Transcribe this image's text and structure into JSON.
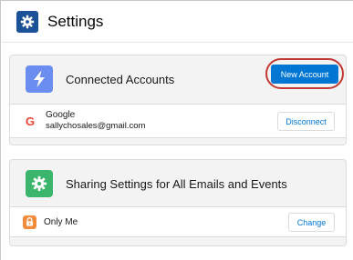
{
  "header": {
    "title": "Settings",
    "icon": "gear-icon"
  },
  "connected_accounts": {
    "title": "Connected Accounts",
    "icon": "lightning-bolt-icon",
    "new_account_label": "New Account",
    "account": {
      "provider_logo": "G",
      "provider": "Google",
      "email": "sallychosales@gmail.com",
      "disconnect_label": "Disconnect"
    }
  },
  "sharing": {
    "title": "Sharing Settings for All Emails and Events",
    "icon": "gear-icon",
    "option": {
      "icon": "lock-icon",
      "label": "Only Me",
      "change_label": "Change"
    }
  },
  "colors": {
    "header_icon": "#1b5297",
    "bolt_icon": "#6b8cf0",
    "gear_icon": "#3bb56b",
    "lock_icon": "#f28b3c",
    "brand_blue": "#0176d3",
    "highlight": "#c23934"
  }
}
